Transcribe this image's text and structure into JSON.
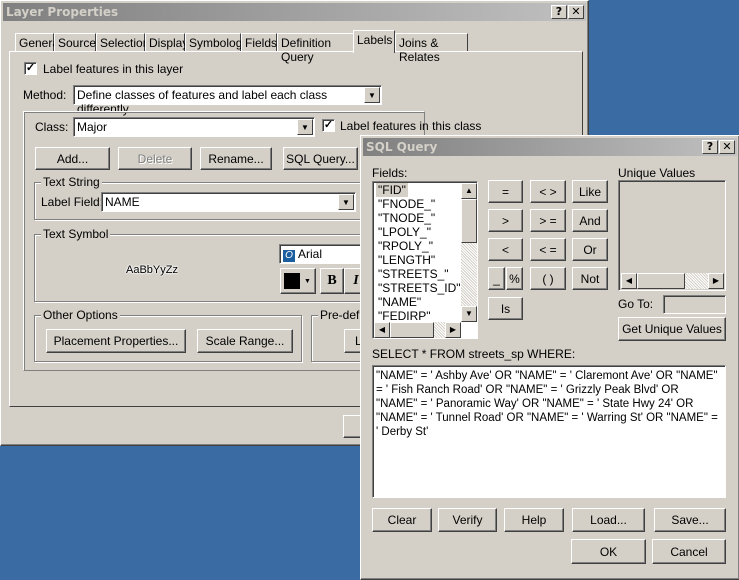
{
  "layer_properties": {
    "title": "Layer Properties",
    "tabs": [
      "General",
      "Source",
      "Selection",
      "Display",
      "Symbology",
      "Fields",
      "Definition Query",
      "Labels",
      "Joins & Relates"
    ],
    "active_tab": "Labels",
    "label_features_layer": "Label features in this layer",
    "label_features_layer_checked": true,
    "method_label": "Method:",
    "method_value": "Define classes of features and label each class differently.",
    "class_label": "Class:",
    "class_value": "Major",
    "label_features_class": "Label features in this class",
    "label_features_class_checked": true,
    "buttons": {
      "add": "Add...",
      "delete": "Delete",
      "rename": "Rename...",
      "sql_query": "SQL Query..."
    },
    "text_string": {
      "title": "Text String",
      "label_field_label": "Label Field:",
      "label_field_value": "NAME"
    },
    "text_symbol": {
      "title": "Text Symbol",
      "preview": "AaBbYyZz",
      "font": "Arial",
      "color": "#000000",
      "bold": "B",
      "italic": "I"
    },
    "other_options": {
      "title": "Other Options",
      "placement": "Placement Properties...",
      "scale_range": "Scale Range..."
    },
    "predefined": {
      "title": "Pre-defir",
      "button": "L"
    }
  },
  "sql_query": {
    "title": "SQL Query",
    "fields_label": "Fields:",
    "fields": [
      "\"FID\"",
      "\"FNODE_\"",
      "\"TNODE_\"",
      "\"LPOLY_\"",
      "\"RPOLY_\"",
      "\"LENGTH\"",
      "\"STREETS_\"",
      "\"STREETS_ID\"",
      "\"NAME\"",
      "\"FEDIRP\""
    ],
    "selected_field": "\"FID\"",
    "operators": [
      "=",
      "< >",
      "Like",
      ">",
      "> =",
      "And",
      "<",
      "< =",
      "Or",
      "_",
      "%",
      "( )",
      "Not",
      "Is"
    ],
    "unique_values_label": "Unique Values",
    "goto_label": "Go To:",
    "goto_value": "",
    "get_unique_values": "Get Unique Values",
    "select_label": "SELECT * FROM streets_sp WHERE:",
    "query": "\"NAME\" = ' Ashby Ave' OR \"NAME\" = ' Claremont Ave' OR \"NAME\" = ' Fish Ranch Road' OR \"NAME\" = ' Grizzly Peak Blvd' OR \"NAME\" = ' Panoramic Way' OR \"NAME\" = ' State Hwy 24' OR \"NAME\" = ' Tunnel Road' OR \"NAME\" = ' Warring St' OR \"NAME\" = ' Derby St'",
    "buttons": {
      "clear": "Clear",
      "verify": "Verify",
      "help": "Help",
      "load": "Load...",
      "save": "Save...",
      "ok": "OK",
      "cancel": "Cancel"
    }
  },
  "title_buttons": {
    "help": "?",
    "close": "✕"
  }
}
